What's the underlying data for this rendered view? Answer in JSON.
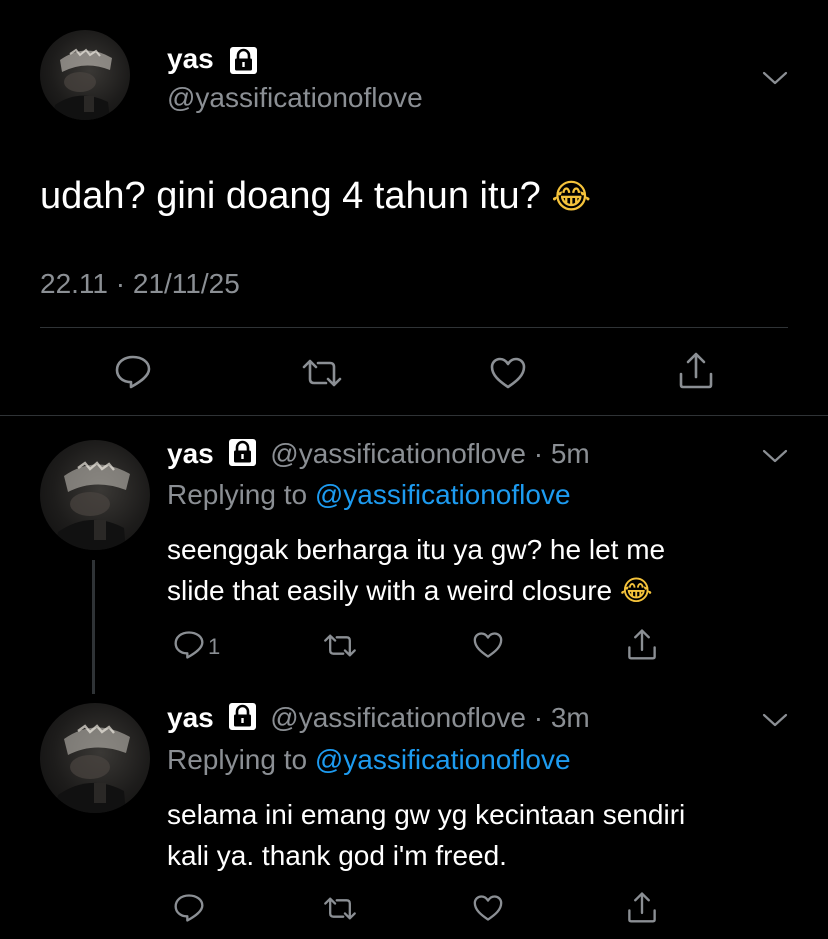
{
  "main_tweet": {
    "name": "yas",
    "handle": "@yassificationoflove",
    "text": "udah? gini doang 4 tahun itu?",
    "emoji": "😂",
    "time": "22.11 · 21/11/25"
  },
  "replies": [
    {
      "name": "yas",
      "handle": "@yassificationoflove",
      "meta": "· 5m",
      "replying_label": "Replying to",
      "replying_to": "@yassificationoflove",
      "line1": "seenggak berharga itu ya gw? he let me",
      "line2": "slide that easily with a weird closure",
      "emoji": "😂",
      "reply_count": "1"
    },
    {
      "name": "yas",
      "handle": "@yassificationoflove",
      "meta": "· 3m",
      "replying_label": "Replying to",
      "replying_to": "@yassificationoflove",
      "line1": "selama ini emang gw yg kecintaan sendiri",
      "line2": "kali ya. thank god i'm freed.",
      "reply_count": ""
    }
  ],
  "icons": {
    "lock": "lock-icon",
    "chevron": "chevron-down-icon",
    "reply": "reply-icon",
    "retweet": "retweet-icon",
    "like": "heart-icon",
    "share": "share-icon"
  },
  "colors": {
    "background": "#000000",
    "text": "#ffffff",
    "muted": "#8b8f94",
    "link": "#1d9bf0",
    "divider": "#2f3336"
  }
}
